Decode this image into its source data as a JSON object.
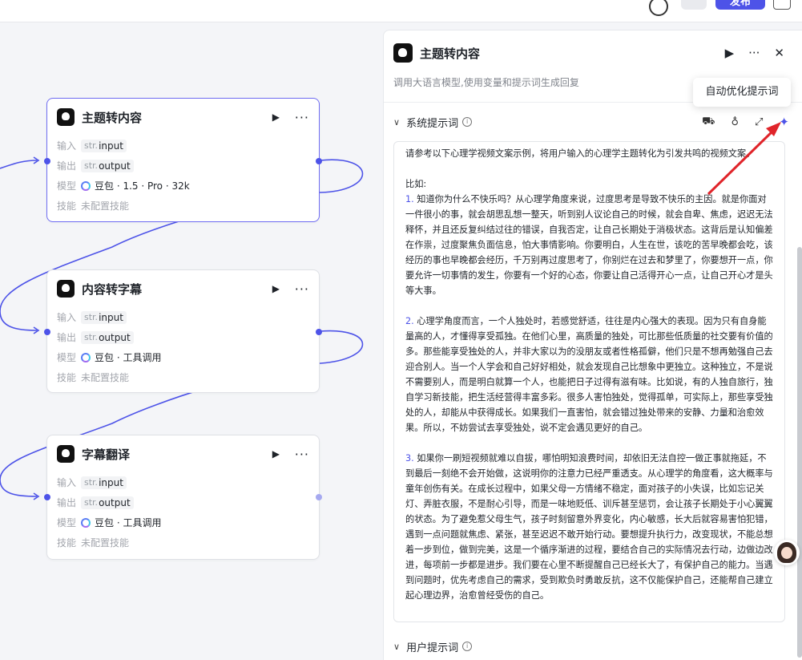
{
  "topbar": {
    "publish_label": "发布"
  },
  "nodes": [
    {
      "title": "主题转内容",
      "input_label": "输入",
      "input_type": "str.",
      "input_name": "input",
      "output_label": "输出",
      "output_type": "str.",
      "output_name": "output",
      "model_label": "模型",
      "model_value": "豆包 · 1.5 · Pro · 32k",
      "skill_label": "技能",
      "skill_value": "未配置技能"
    },
    {
      "title": "内容转字幕",
      "input_label": "输入",
      "input_type": "str.",
      "input_name": "input",
      "output_label": "输出",
      "output_type": "str.",
      "output_name": "output",
      "model_label": "模型",
      "model_value": "豆包 · 工具调用",
      "skill_label": "技能",
      "skill_value": "未配置技能"
    },
    {
      "title": "字幕翻译",
      "input_label": "输入",
      "input_type": "str.",
      "input_name": "input",
      "output_label": "输出",
      "output_type": "str.",
      "output_name": "output",
      "model_label": "模型",
      "model_value": "豆包 · 工具调用",
      "skill_label": "技能",
      "skill_value": "未配置技能"
    }
  ],
  "panel": {
    "title": "主题转内容",
    "description": "调用大语言模型,使用变量和提示词生成回复",
    "system_prompt_title": "系统提示词",
    "user_prompt_title": "用户提示词",
    "tooltip": "自动优化提示词",
    "prompt": {
      "intro": "请参考以下心理学视频文案示例，将用户输入的心理学主题转化为引发共鸣的视频文案。",
      "example_label": "比如:",
      "p1_num": "1.",
      "p1": "知道你为什么不快乐吗？从心理学角度来说，过度思考是导致不快乐的主因。就是你面对一件很小的事，就会胡思乱想一整天，听到别人议论自己的时候，就会自卑、焦虑，迟迟无法释怀，并且还反复纠结过往的错误，自我否定，让自己长期处于消极状态。这背后是认知偏差在作祟，过度聚焦负面信息，怕大事情影响。你要明白，人生在世，该吃的苦早晚都会吃，该经历的事也早晚都会经历，千万别再过度思考了，你别烂在过去和梦里了，你要想开一点，你要允许一切事情的发生，你要有一个好的心态，你要让自己活得开心一点，让自己开心才是头等大事。",
      "p2_num": "2.",
      "p2": "心理学角度而言，一个人独处时，若感觉舒适，往往是内心强大的表现。因为只有自身能量高的人，才懂得享受孤独。在他们心里，高质量的独处，可比那些低质量的社交要有价值的多。那些能享受独处的人，并非大家以为的没朋友或者性格孤僻，他们只是不想再勉强自己去迎合别人。当一个人学会和自己好好相处，就会发现自己比想象中更独立。这种独立，不是说不需要别人，而是明白就算一个人，也能把日子过得有滋有味。比如说，有的人独自旅行，独自学习新技能，把生活经营得丰富多彩。很多人害怕独处，觉得孤单，可实际上，那些享受独处的人，却能从中获得成长。如果我们一直害怕，就会错过独处带来的安静、力量和治愈效果。所以，不妨尝试去享受独处，说不定会遇见更好的自己。",
      "p3_num": "3.",
      "p3": "如果你一刷短视频就难以自拔，哪怕明知浪费时间，却依旧无法自控一做正事就拖延，不到最后一刻绝不会开始做，这说明你的注意力已经严重透支。从心理学的角度看，这大概率与童年创伤有关。在成长过程中，如果父母一方情绪不稳定，面对孩子的小失误，比如忘记关灯、弄脏衣服，不是耐心引导，而是一味地贬低、训斥甚至惩罚，会让孩子长期处于小心翼翼的状态。为了避免惹父母生气，孩子时刻留意外界变化，内心敏感，长大后就容易害怕犯错，遇到一点问题就焦虑、紧张，甚至迟迟不敢开始行动。要想提升执行力，改变现状，不能总想着一步到位，做到完美，这是一个循序渐进的过程，要结合自己的实际情况去行动，边做边改进，每项前一步都是进步。我们要在心里不断提醒自己已经长大了，有保护自己的能力。当遇到问题时，优先考虑自己的需求，受到欺负时勇敢反抗，这不仅能保护自己，还能帮自己建立起心理边界，治愈曾经受伤的自己。"
    }
  },
  "colors": {
    "accent": "#4d53e8",
    "arrow": "#e0242a"
  },
  "icons": {
    "play": "▶",
    "more": "···",
    "close": "✕",
    "chevron": "∨",
    "expand": "⤢",
    "bulb": "♁",
    "magic": "✦"
  }
}
